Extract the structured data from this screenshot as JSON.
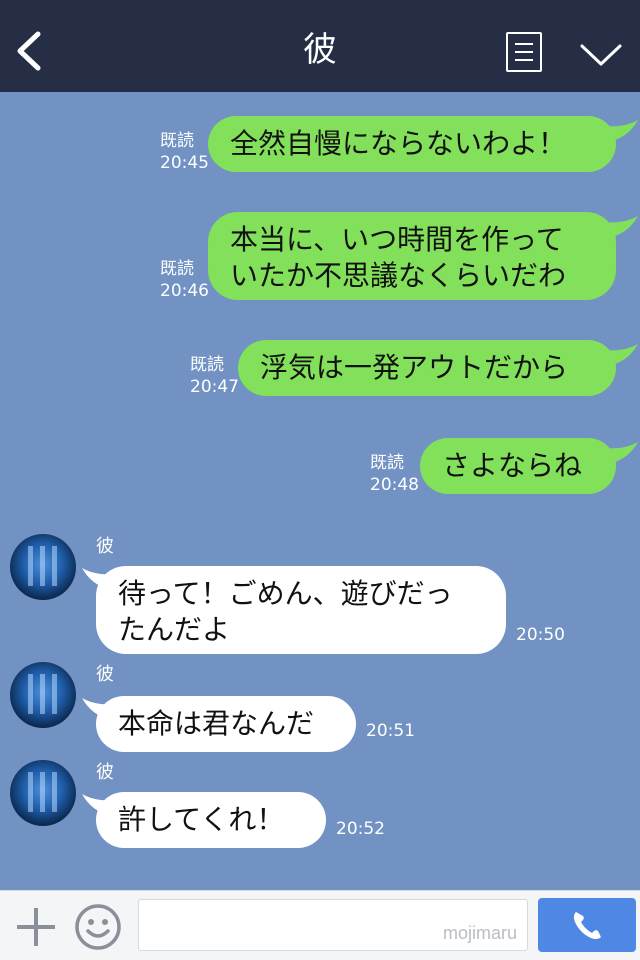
{
  "header": {
    "title": "彼",
    "back_icon": "chevron-left-icon",
    "menu_icon": "menu-list-icon",
    "collapse_icon": "chevron-down-icon"
  },
  "messages_out": [
    {
      "read": "既読",
      "time": "20:45",
      "text_lines": [
        "全然自慢にならないわよ！"
      ]
    },
    {
      "read": "既読",
      "time": "20:46",
      "text_lines": [
        "本当に、いつ時間を作って",
        "いたか不思議なくらいだわ"
      ]
    },
    {
      "read": "既読",
      "time": "20:47",
      "text_lines": [
        "浮気は一発アウトだから"
      ]
    },
    {
      "read": "既読",
      "time": "20:48",
      "text_lines": [
        "さよならね"
      ]
    }
  ],
  "messages_in": [
    {
      "sender": "彼",
      "time": "20:50",
      "text_lines": [
        "待って！ごめん、遊びだっ",
        "たんだよ"
      ]
    },
    {
      "sender": "彼",
      "time": "20:51",
      "text_lines": [
        "本命は君なんだ"
      ]
    },
    {
      "sender": "彼",
      "time": "20:52",
      "text_lines": [
        "許してくれ！"
      ]
    }
  ],
  "footer": {
    "input_value": "",
    "watermark": "mojimaru",
    "plus_icon": "plus-icon",
    "emoji_icon": "smiley-icon",
    "call_icon": "phone-icon"
  },
  "colors": {
    "background": "#7192c2",
    "header": "#252e45",
    "outgoing_bubble": "#83e05a",
    "incoming_bubble": "#ffffff",
    "call_button": "#4e87e4"
  }
}
